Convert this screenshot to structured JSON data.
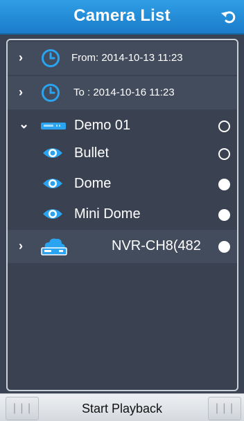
{
  "header": {
    "title": "Camera List",
    "back_icon": "undo-icon"
  },
  "rows": [
    {
      "label": "From: 2014-10-13  11:23",
      "icon": "clock-icon"
    },
    {
      "label": "To   : 2014-10-16  11:23",
      "icon": "clock-icon"
    },
    {
      "label": "Demo 01",
      "icon": "dvr-device-icon"
    },
    {
      "label": "Bullet",
      "icon": "eye-icon"
    },
    {
      "label": "Dome",
      "icon": "eye-icon"
    },
    {
      "label": "Mini Dome",
      "icon": "eye-icon"
    },
    {
      "label": "NVR-CH8(482",
      "icon": "cloud-nvr-icon"
    }
  ],
  "footer": {
    "start_label": "Start Playback"
  },
  "colors": {
    "accent": "#2592dc",
    "panel": "#3a4252",
    "row_alt": "#434c5c"
  }
}
